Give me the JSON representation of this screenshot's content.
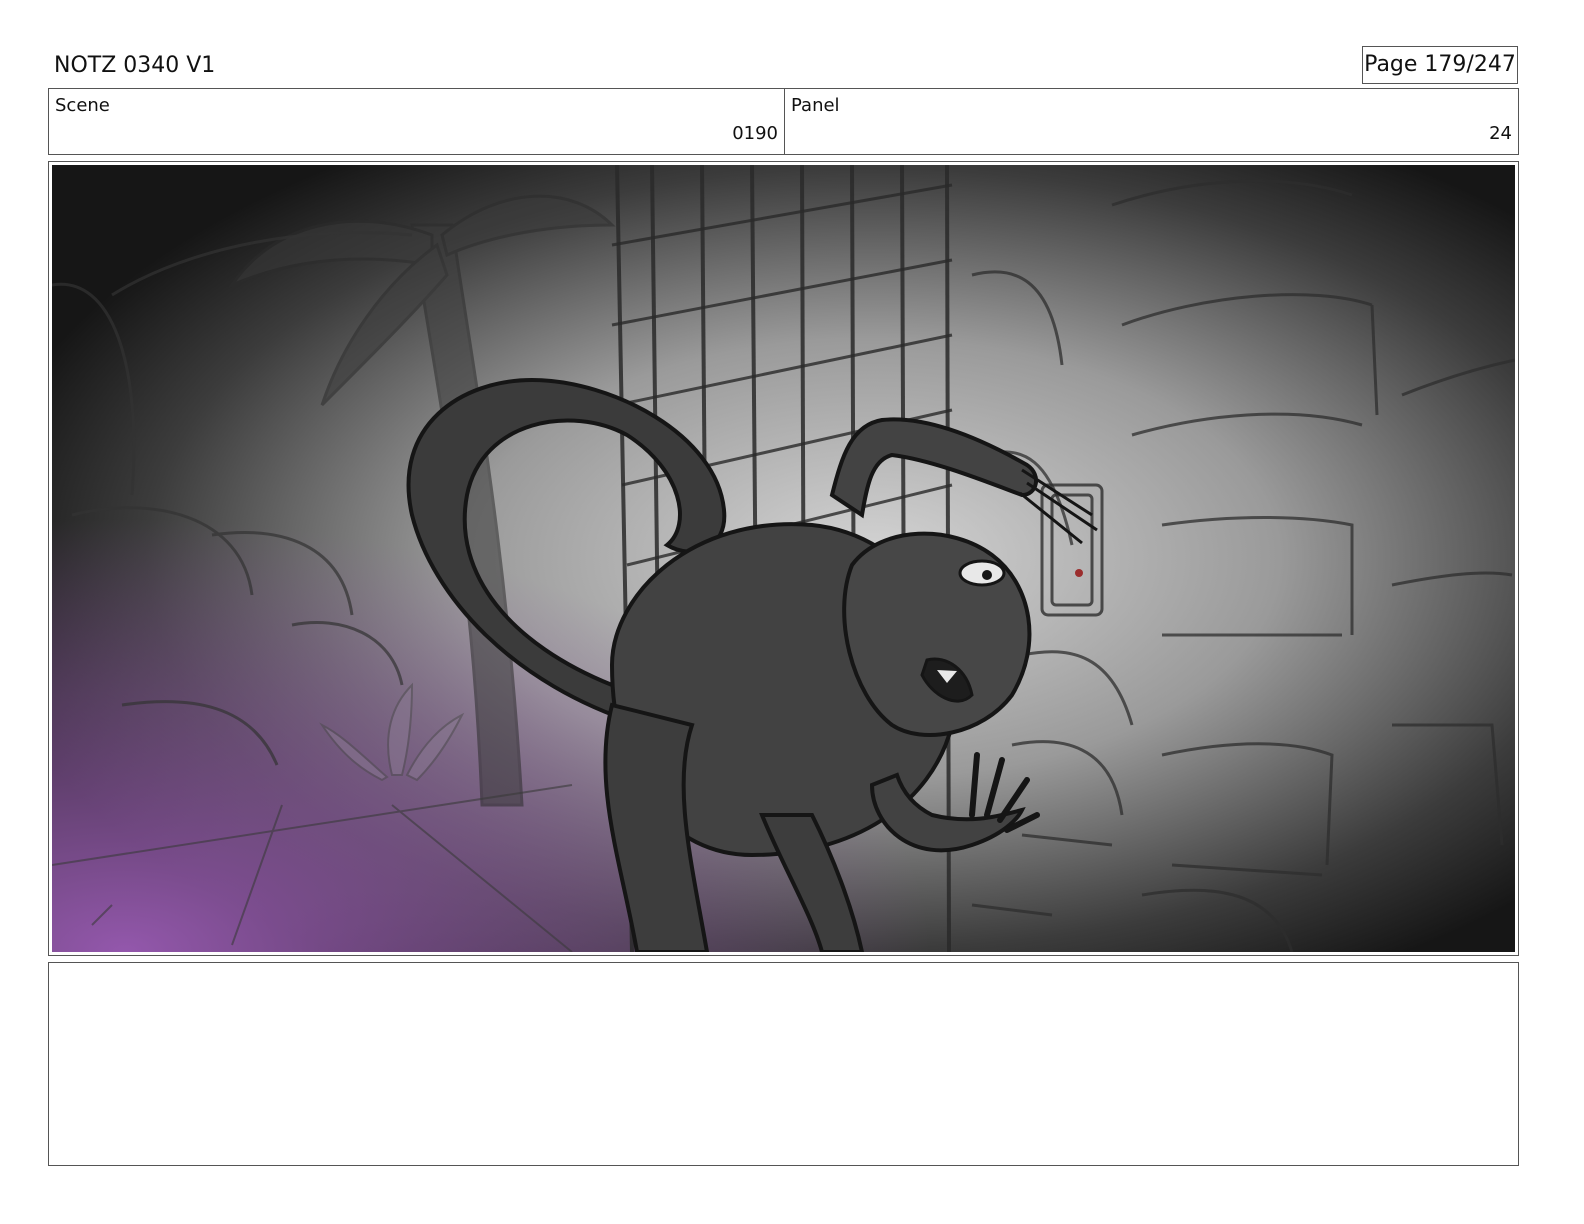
{
  "header": {
    "title": "NOTZ 0340 V1",
    "page_label": "Page 179/247"
  },
  "info": {
    "scene_label": "Scene",
    "scene_value": "0190",
    "panel_label": "Panel",
    "panel_value": "24"
  },
  "notes": {
    "text": ""
  },
  "colors": {
    "border": "#555555",
    "vignette_dark": "#161616",
    "glow_light": "#d2d2d2",
    "accent_purple": "#9a62b0"
  }
}
